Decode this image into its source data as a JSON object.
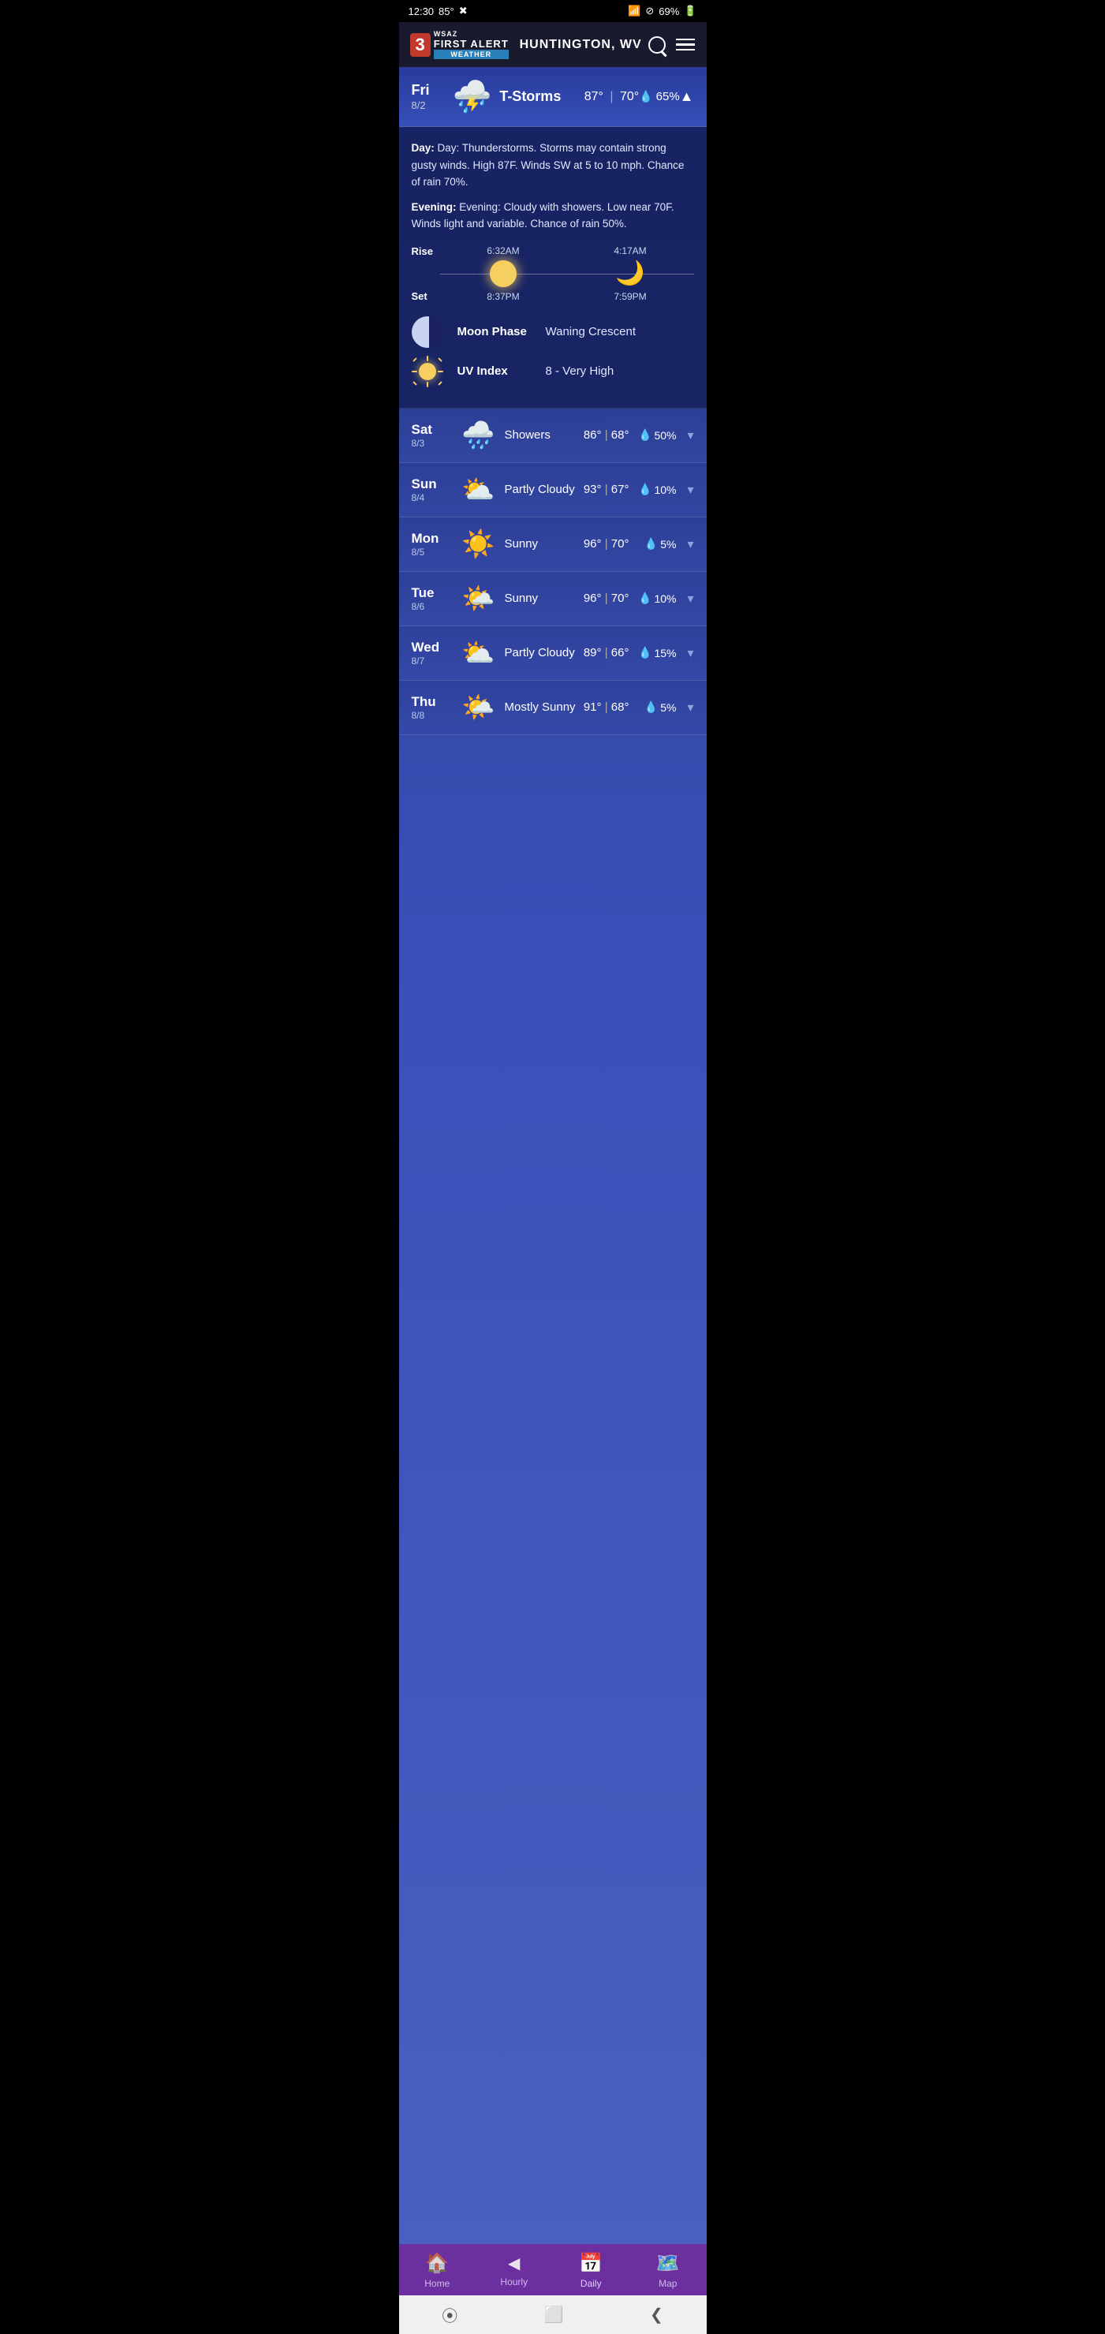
{
  "status_bar": {
    "time": "12:30",
    "temp": "85°",
    "battery": "69%"
  },
  "header": {
    "logo_number": "3",
    "logo_first": "WSAZ",
    "logo_alert": "FIRST ALERT",
    "logo_weather": "WEATHER",
    "city": "HUNTINGTON, WV",
    "search_label": "search",
    "menu_label": "menu"
  },
  "featured": {
    "day": "Fri",
    "date": "8/2",
    "condition": "T-Storms",
    "high": "87°",
    "low": "70°",
    "rain": "65%",
    "expanded": true
  },
  "detail": {
    "day_text": "Day: Thunderstorms. Storms may contain strong gusty winds. High 87F. Winds SW at 5 to 10 mph. Chance of rain 70%.",
    "evening_text": "Evening: Cloudy with showers. Low near 70F. Winds light and variable. Chance of rain 50%.",
    "sun_rise": "6:32AM",
    "sun_set": "8:37PM",
    "moon_rise": "4:17AM",
    "moon_set": "7:59PM",
    "moon_phase_label": "Moon Phase",
    "moon_phase_value": "Waning Crescent",
    "uv_index_label": "UV Index",
    "uv_index_value": "8 - Very High"
  },
  "forecast": [
    {
      "day": "Sat",
      "date": "8/3",
      "condition": "Showers",
      "high": "86°",
      "low": "68°",
      "rain": "50%",
      "icon": "🌧️"
    },
    {
      "day": "Sun",
      "date": "8/4",
      "condition": "Partly Cloudy",
      "high": "93°",
      "low": "67°",
      "rain": "10%",
      "icon": "⛅"
    },
    {
      "day": "Mon",
      "date": "8/5",
      "condition": "Sunny",
      "high": "96°",
      "low": "70°",
      "rain": "5%",
      "icon": "☀️"
    },
    {
      "day": "Tue",
      "date": "8/6",
      "condition": "Sunny",
      "high": "96°",
      "low": "70°",
      "rain": "10%",
      "icon": "🌤️"
    },
    {
      "day": "Wed",
      "date": "8/7",
      "condition": "Partly Cloudy",
      "high": "89°",
      "low": "66°",
      "rain": "15%",
      "icon": "⛅"
    },
    {
      "day": "Thu",
      "date": "8/8",
      "condition": "Mostly Sunny",
      "high": "91°",
      "low": "68°",
      "rain": "5%",
      "icon": "🌤️"
    }
  ],
  "nav": {
    "items": [
      {
        "label": "Home",
        "icon": "🏠",
        "active": false
      },
      {
        "label": "Hourly",
        "icon": "◀",
        "active": false
      },
      {
        "label": "Daily",
        "icon": "📅",
        "active": true
      },
      {
        "label": "Map",
        "icon": "🗺️",
        "active": false
      }
    ]
  },
  "rise_label": "Rise",
  "set_label": "Set"
}
